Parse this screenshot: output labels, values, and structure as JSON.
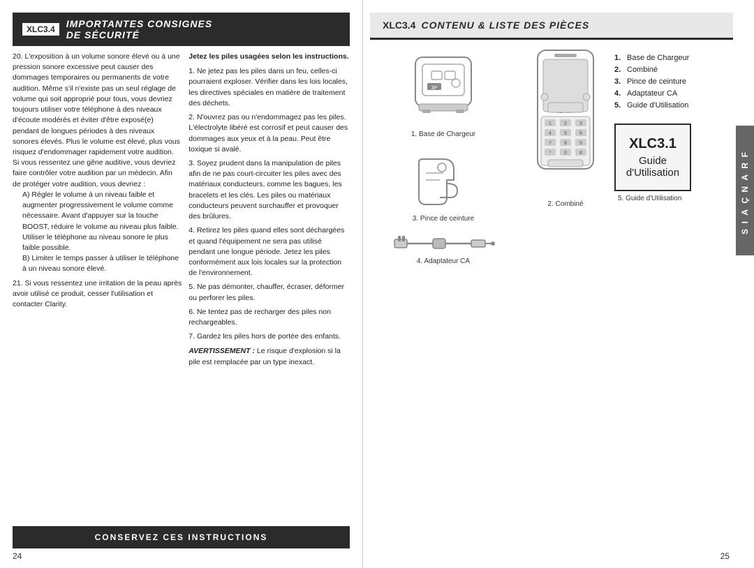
{
  "left_page": {
    "header": {
      "model": "XLC3.4",
      "line1": "Importantes Consignes",
      "line2": "De Sécurité"
    },
    "col1_content": [
      "20.  L'exposition à un volume",
      "sonore élevé ou à une pression",
      "sonore excessive peut",
      "causer des dommages",
      "temporaires ou permanents de",
      "votre audition. Même s'il n'existe",
      "pas un seul réglage de volume",
      "qui soit approprié pour tous,",
      "vous devriez toujours utiliser",
      "votre téléphone à des niveaux",
      "d'écoute modérés et éviter",
      "d'être exposé(e) pendant de",
      "longues périodes à des niveaux",
      "sonores élevés. Plus le volume",
      "est élevé, plus vous risquez",
      "d'endommager rapidement votre",
      "audition. Si vous ressentez une",
      "gêne auditive, vous devriez",
      "faire contrôler votre audition par",
      "un médecin. Afin de protéger",
      "votre audition, vous devriez :"
    ],
    "col1_indent": [
      "A) Régler le volume à un",
      "niveau faible et augmenter",
      "progressivement le volume",
      "comme nécessaire. Avant",
      "d'appuyer sur la touche",
      "BOOST, réduire le volume",
      "au niveau plus faible. Utiliser",
      "le téléphone au niveau",
      "sonore le plus faible possible.",
      "B) Limiter le temps passer à",
      "utiliser le téléphone",
      "à un niveau sonore élevé."
    ],
    "col1_item21": "21. Si vous ressentez une irritation",
    "col1_item21b": [
      "de la peau après avoir utilisé",
      "ce produit, cesser l'utilisation et",
      "contacter Clarity."
    ],
    "col2_header_bold": "Jetez les piles usagées selon les instructions.",
    "col2_items": [
      "1. Ne jetez pas les piles dans un feu, celles-ci pourraient exploser. Vérifier dans les lois locales, les directives spéciales en matière de traitement des déchets.",
      "2. N'ouvrez pas ou n'endommagez pas les piles. L'électrolyte libéré est corrosif et peut causer des dommages aux yeux et à la peau. Peut être toxique si avalé.",
      "3. Soyez prudent dans la manipulation de piles afin de ne pas court-circuiter les piles avec des matériaux conducteurs, comme les bagues, les bracelets et les clés. Les piles ou matériaux conducteurs peuvent surchauffer et provoquer des brûlures.",
      "4. Retirez les piles quand elles sont déchargées et quand l'équipement ne sera pas utilisé pendant une longue période. Jetez les piles conformément aux lois locales sur la protection de l'environnement.",
      "5. Ne pas démonter, chauffer, écraser, déformer ou perforer les piles.",
      "6. Ne tentez pas de recharger des piles non rechargeables.",
      "7. Gardez les piles hors de portée des enfants."
    ],
    "warning_label": "AVERTISSEMENT :",
    "warning_text": " Le risque d'explosion si la pile est remplacée par un type inexact.",
    "footer": "CONSERVEZ CES INSTRUCTIONS",
    "page_number": "24"
  },
  "right_page": {
    "header": {
      "model": "XLC3.4",
      "title": "Contenu & Liste des Pièces"
    },
    "parts": [
      {
        "num": "1.",
        "label": "Base de Chargeur"
      },
      {
        "num": "2.",
        "label": "Combiné"
      },
      {
        "num": "3.",
        "label": "Pince de ceinture"
      },
      {
        "num": "4.",
        "label": "Adaptateur CA"
      },
      {
        "num": "5.",
        "label": "Guide d'Utilisation"
      }
    ],
    "captions": {
      "charger": "1.  Base de Chargeur",
      "combine": "2.  Combiné",
      "pince": "3.  Pince de ceinture",
      "adaptateur": "4.  Adaptateur CA",
      "guide": "5.  Guide d'Utilisation"
    },
    "xlc_box": {
      "title": "XLC3.1",
      "line1": "Guide",
      "line2": "d'Utilisation"
    },
    "side_tab": "FRANÇAIS",
    "page_number": "25"
  }
}
